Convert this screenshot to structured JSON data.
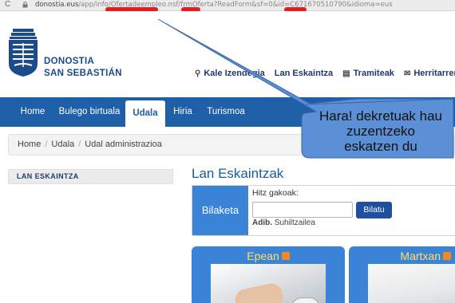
{
  "browser": {
    "reload_glyph": "C",
    "url_host": "donostia.eus",
    "url_path": "/app/info/Ofertadeempleo.nsf/frmOferta?ReadForm&sf=0&id=C671670510790&idioma=eus"
  },
  "header": {
    "logo_line1": "DONOSTIA",
    "logo_line2": "SAN SEBASTIÁN",
    "top_nav": [
      {
        "label": "Kale Izendegia",
        "icon": "map-pin-icon",
        "glyph": "⚲"
      },
      {
        "label": "Lan Eskaintza",
        "icon": "",
        "glyph": ""
      },
      {
        "label": "Tramiteak",
        "icon": "briefcase-icon",
        "glyph": "▤"
      },
      {
        "label": "Herritarren p",
        "icon": "mail-icon",
        "glyph": "✉"
      }
    ]
  },
  "navbar": {
    "tabs": [
      "Home",
      "Bulego birtuala",
      "Udala",
      "Hiria",
      "Turismoa"
    ],
    "active": "Udala"
  },
  "breadcrumb": {
    "items": [
      "Home",
      "Udala",
      "Udal administrazioa"
    ]
  },
  "sidebar": {
    "title": "LAN ESKAINTZA"
  },
  "main": {
    "title": "Lan Eskaintzak",
    "search": {
      "block_label": "Bilaketa",
      "keywords_label": "Hitz gakoak:",
      "input_value": "",
      "button_label": "Bilatu",
      "example_prefix": "Adib.",
      "example_value": "Suhiltzailea"
    },
    "cards": [
      {
        "title": "Epean",
        "icon": "rss-icon"
      },
      {
        "title": "Martxan",
        "icon": "rss-icon"
      }
    ]
  },
  "annotation": {
    "line1": "Hara! dekretuak hau",
    "line2": "zuzentzeko",
    "line3": "eskatzen du",
    "fill_color": "#5b8fd6",
    "mark_color": "#e02020"
  }
}
